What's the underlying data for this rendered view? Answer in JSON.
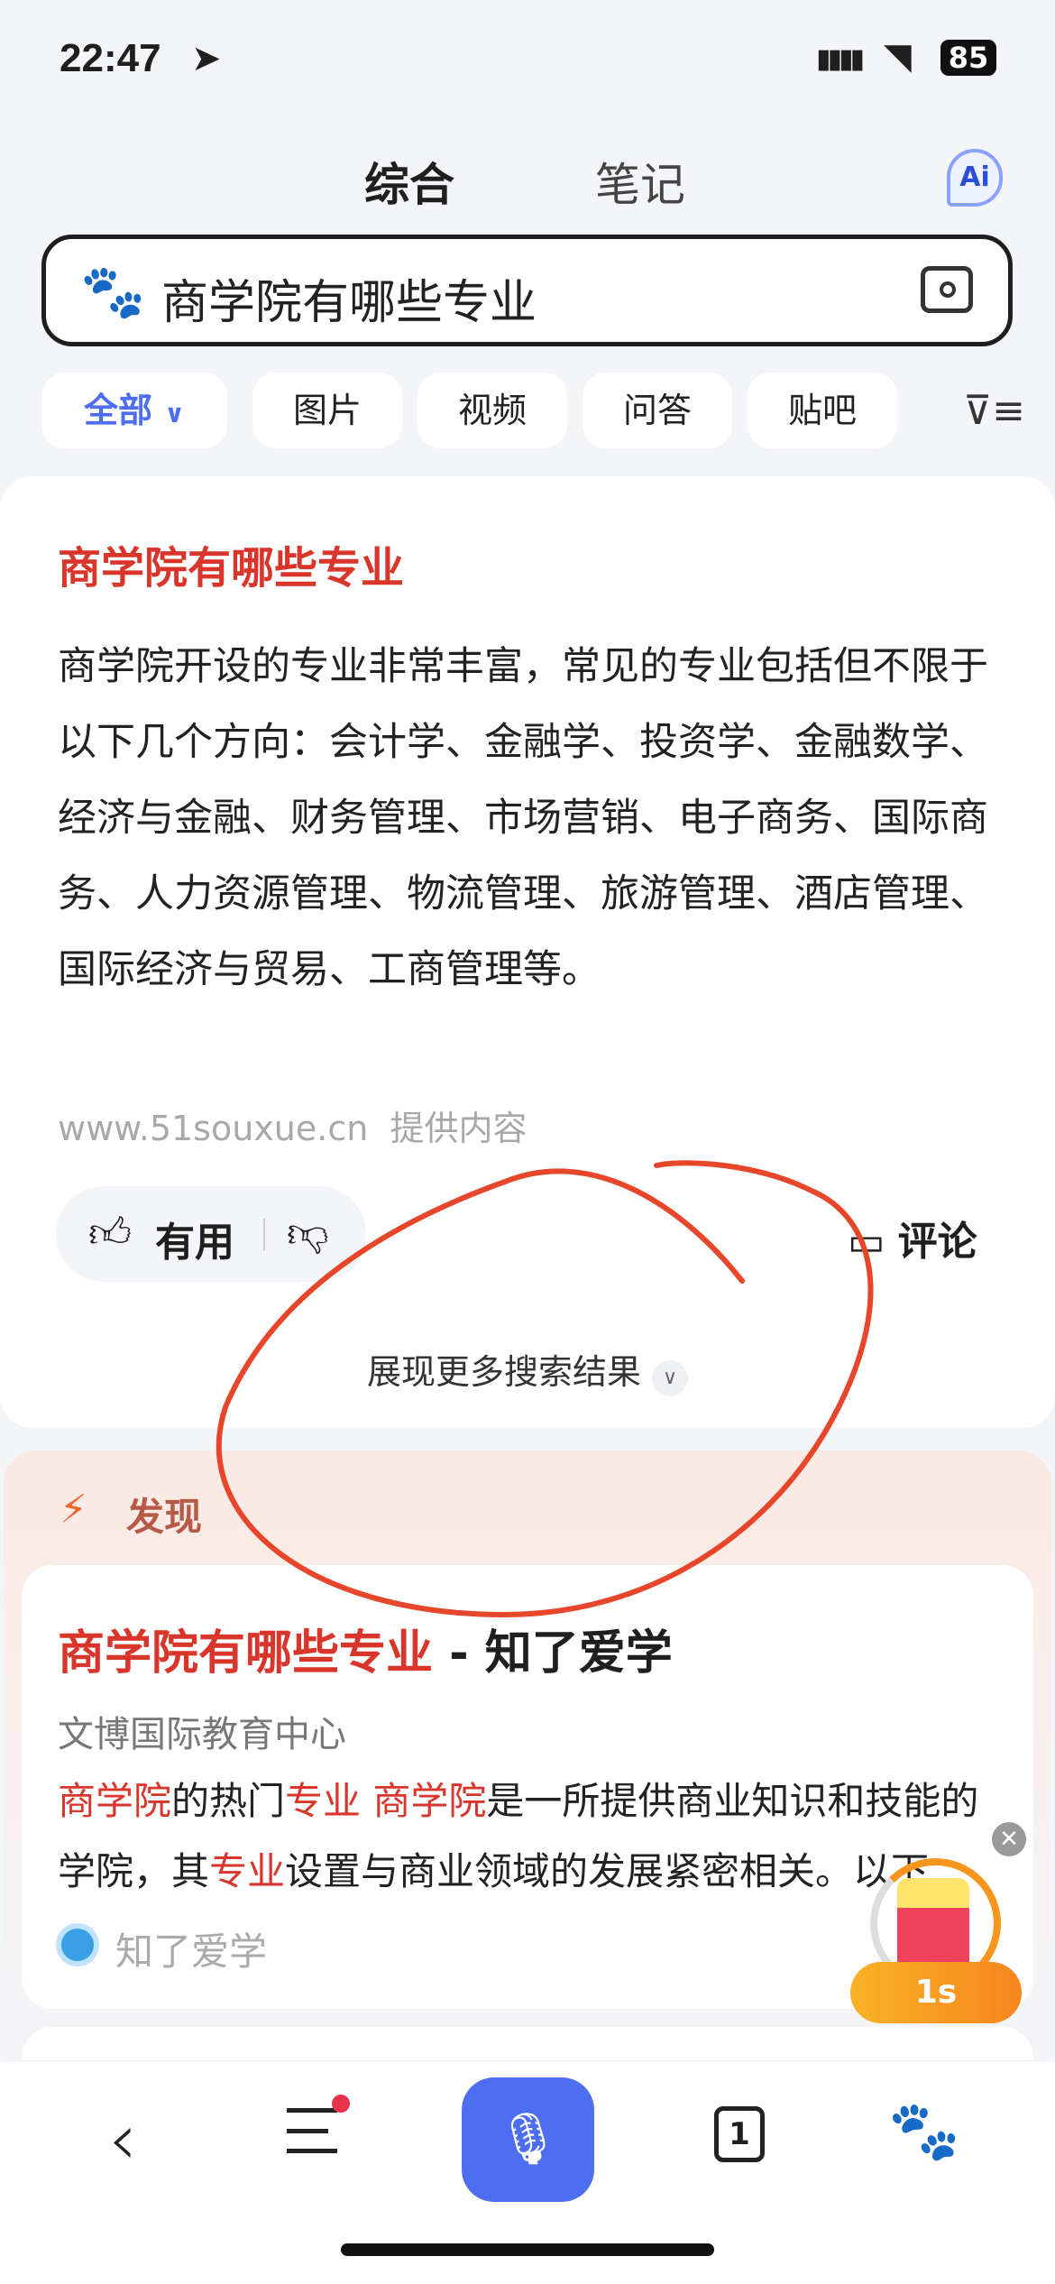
{
  "status": {
    "time": "22:47",
    "battery": "85"
  },
  "tabs": [
    {
      "label": "综合",
      "active": true
    },
    {
      "label": "笔记",
      "active": false
    }
  ],
  "ai_button": "Ai",
  "search": {
    "value": "商学院有哪些专业"
  },
  "filters": [
    {
      "label": "全部",
      "active": true
    },
    {
      "label": "图片"
    },
    {
      "label": "视频"
    },
    {
      "label": "问答"
    },
    {
      "label": "贴吧"
    }
  ],
  "answer_card": {
    "title": "商学院有哪些专业",
    "body": "商学院开设的专业非常丰富，常见的专业包括但不限于以下几个方向：会计学、金融学、投资学、金融数学、经济与金融、财务管理、市场营销、电子商务、国际商务、人力资源管理、物流管理、旅游管理、酒店管理、国际经济与贸易、工商管理等。",
    "source": "www.51souxue.cn",
    "source_suffix": "提供内容",
    "useful_label": "有用",
    "comment_label": "评论"
  },
  "show_more": "展现更多搜索结果",
  "discover": {
    "label": "发现",
    "result": {
      "title_highlight": "商学院有哪些专业",
      "title_rest": " - 知了爱学",
      "site": "文博国际教育中心",
      "snippet": [
        {
          "t": "商学院",
          "h": true
        },
        {
          "t": "的热门",
          "h": false
        },
        {
          "t": "专业",
          "h": true
        },
        {
          "t": " ",
          "h": false
        },
        {
          "t": "商学院",
          "h": true
        },
        {
          "t": "是一所提供商业知识和技能的学院，其",
          "h": false
        },
        {
          "t": "专业",
          "h": true
        },
        {
          "t": "设置与商业领域的发展紧密相关。以下...",
          "h": false
        }
      ],
      "brand": "知了爱学"
    }
  },
  "floating_timer": "1s",
  "bottom_nav": {
    "tab_count": "1"
  },
  "colors": {
    "accent": "#4e6ef2",
    "highlight": "#d9352b",
    "annotation": "#e8462a"
  }
}
